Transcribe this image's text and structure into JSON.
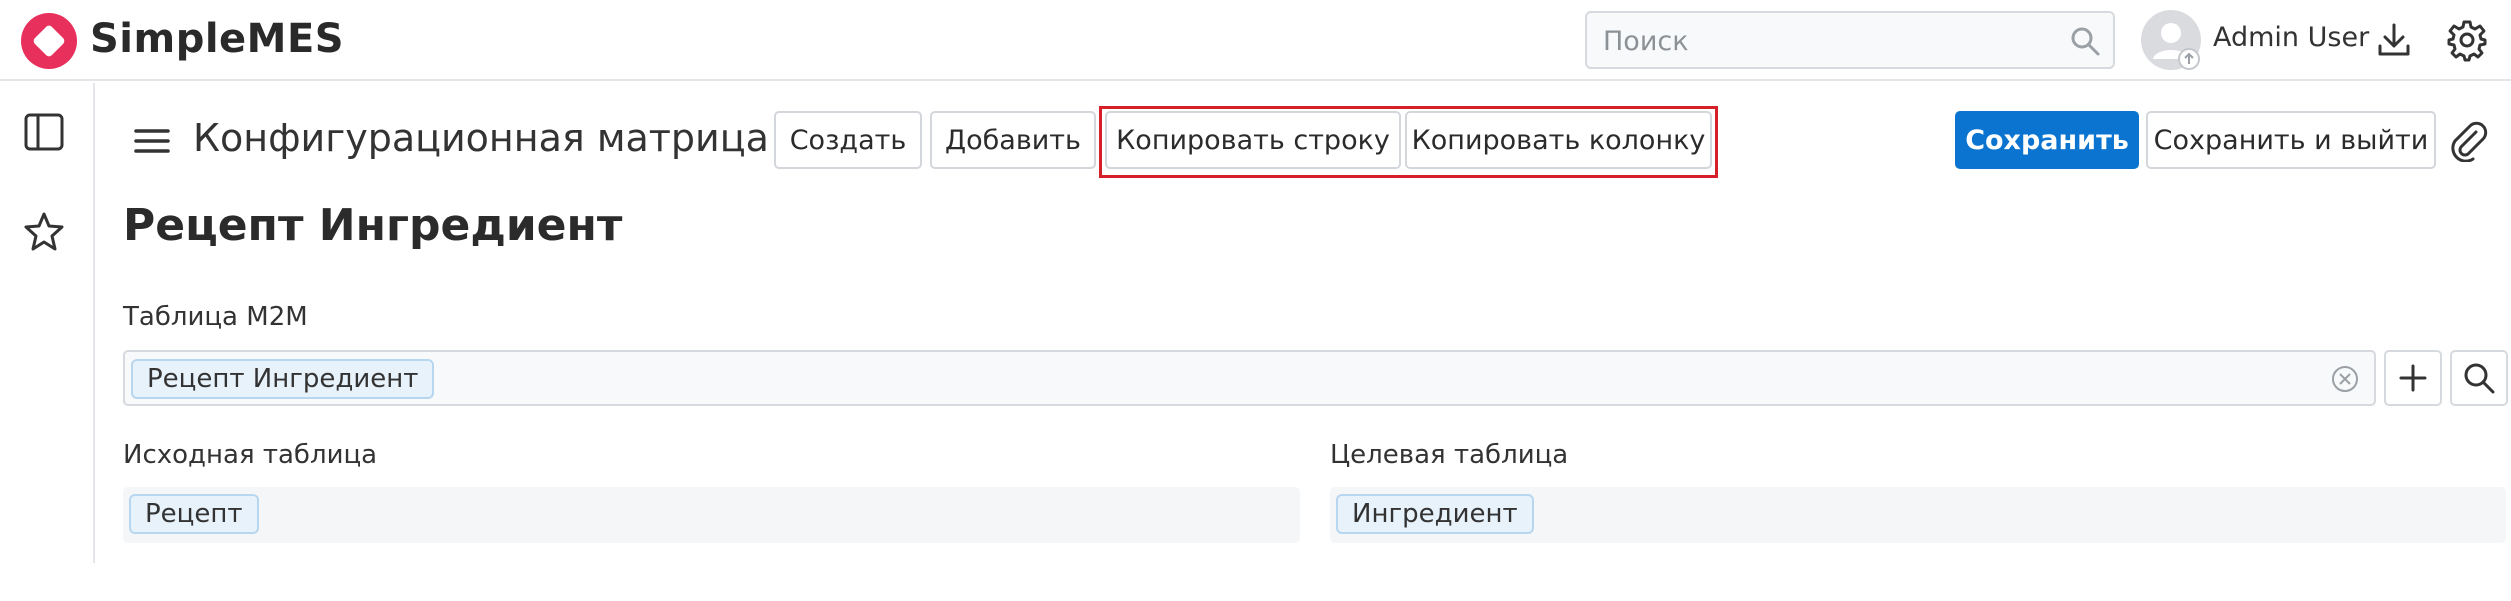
{
  "app": {
    "name": "SimpleMES",
    "brand_color": "#e8305c"
  },
  "header": {
    "search_placeholder": "Поиск",
    "user_name": "Admin User"
  },
  "toolbar": {
    "title": "Конфигурационная матрица",
    "create_label": "Создать",
    "add_label": "Добавить",
    "copy_row_label": "Копировать строку",
    "copy_column_label": "Копировать колонку",
    "save_label": "Сохранить",
    "save_exit_label": "Сохранить и выйти",
    "highlight_color": "#d5202a",
    "primary_color": "#0b74d1"
  },
  "form": {
    "heading": "Рецепт Ингредиент",
    "m2m_label": "Таблица M2M",
    "m2m_value": "Рецепт Ингредиент",
    "source_label": "Исходная таблица",
    "source_value": "Рецепт",
    "target_label": "Целевая таблица",
    "target_value": "Ингредиент"
  },
  "icons": [
    "logo-icon",
    "search-icon",
    "avatar",
    "download-icon",
    "gear-icon",
    "sidebar-toggle-icon",
    "star-icon",
    "menu-icon",
    "paperclip-icon",
    "clear-icon",
    "plus-icon",
    "search-icon"
  ]
}
